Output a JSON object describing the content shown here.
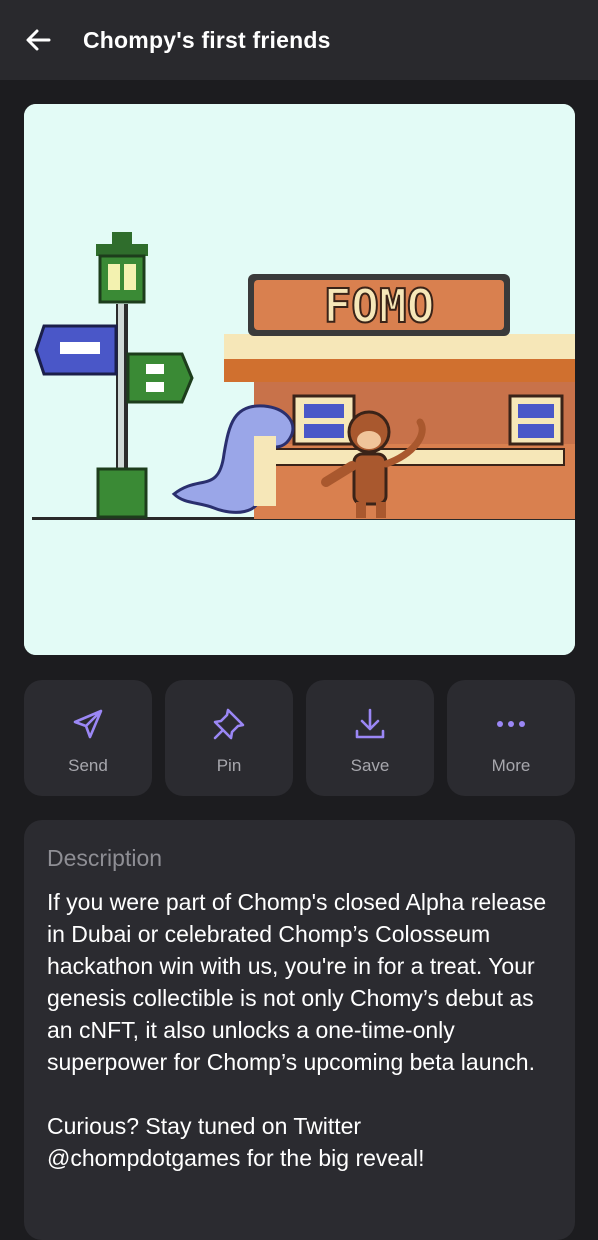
{
  "header": {
    "title": "Chompy's first friends"
  },
  "artwork": {
    "sign_text": "FOMO",
    "background_color": "#e3fbf6"
  },
  "actions": [
    {
      "label": "Send",
      "icon": "send-icon"
    },
    {
      "label": "Pin",
      "icon": "pin-icon"
    },
    {
      "label": "Save",
      "icon": "download-icon"
    },
    {
      "label": "More",
      "icon": "more-icon"
    }
  ],
  "description": {
    "title": "Description",
    "paragraphs": [
      "If you were part of Chomp's closed Alpha release in Dubai or celebrated Chomp’s Colosseum hackathon win with us, you're in for a treat. Your genesis collectible is not only Chomy’s debut as an cNFT, it also unlocks a one-time-only superpower for Chomp’s upcoming beta launch.",
      "Curious? Stay tuned on Twitter @chompdotgames for the big reveal!"
    ]
  },
  "colors": {
    "accent": "#9b87f5",
    "header_bg": "#29292d",
    "card_bg": "#2b2b30",
    "page_bg": "#1c1c1f"
  }
}
